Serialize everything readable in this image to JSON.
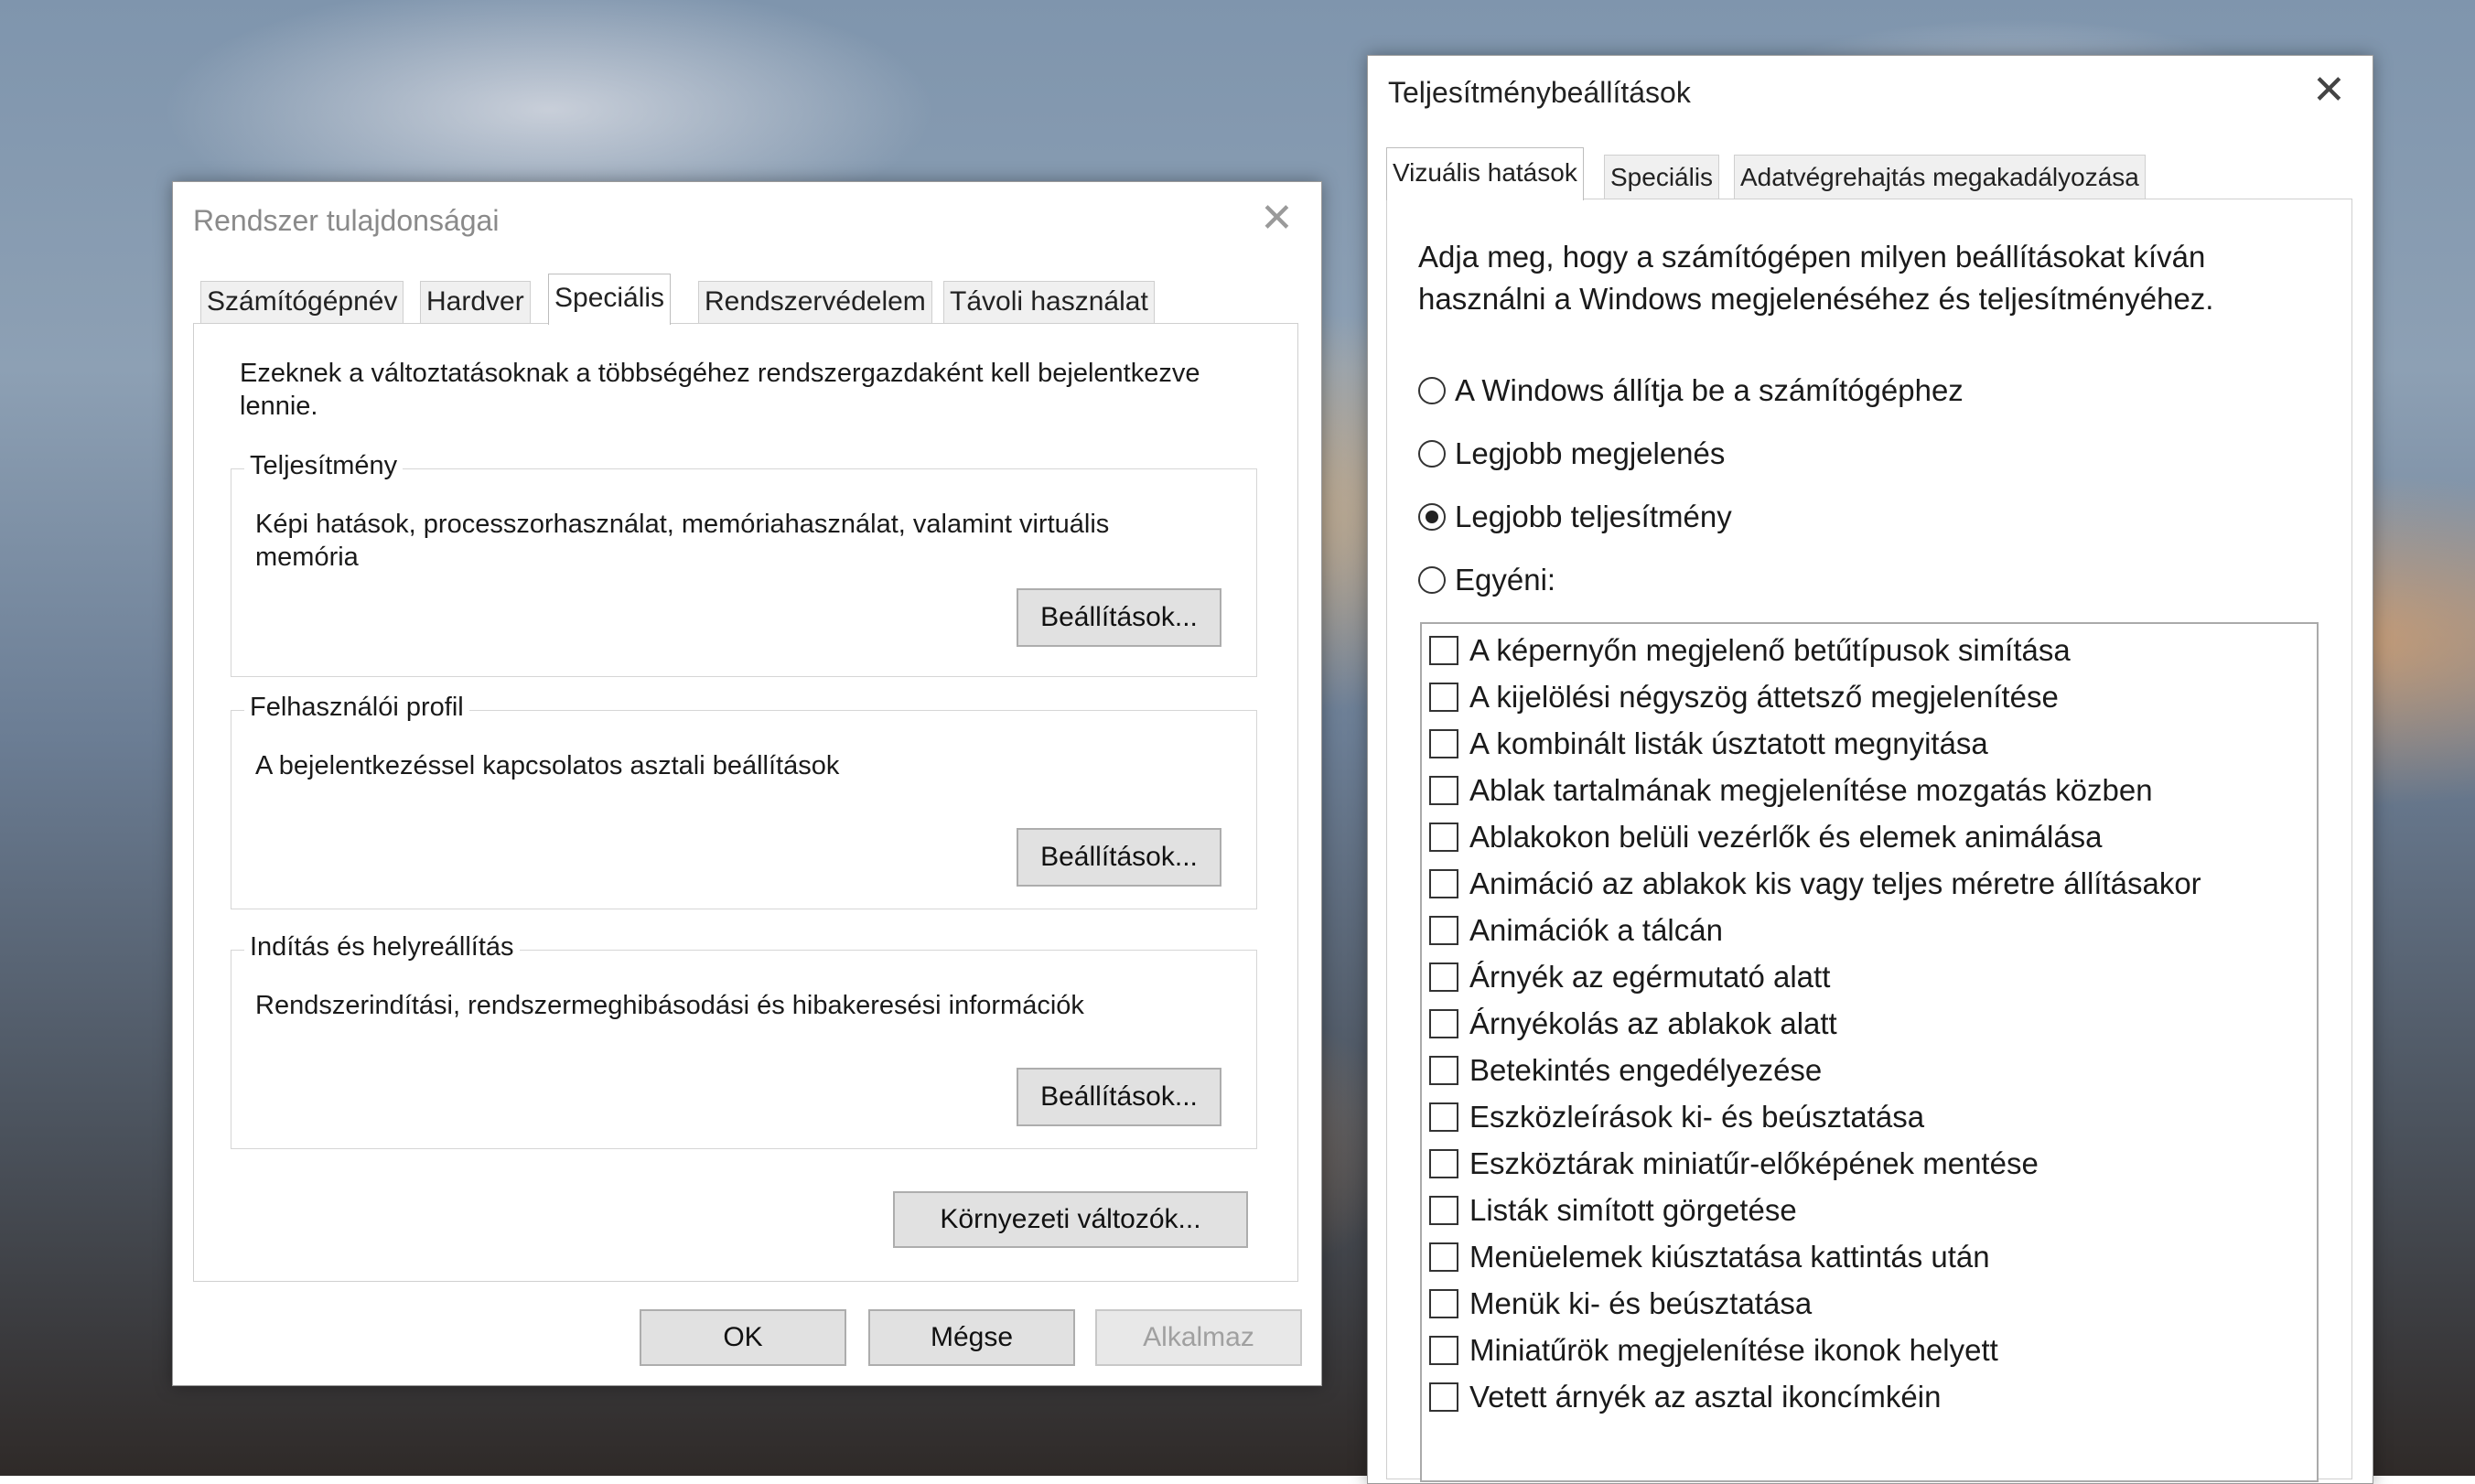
{
  "sys_dialog": {
    "title": "Rendszer tulajdonságai",
    "tabs": [
      {
        "label": "Számítógépnév"
      },
      {
        "label": "Hardver"
      },
      {
        "label": "Speciális"
      },
      {
        "label": "Rendszervédelem"
      },
      {
        "label": "Távoli használat"
      }
    ],
    "admin_note": "Ezeknek a változtatásoknak a többségéhez rendszergazdaként kell bejelentkezve lennie.",
    "performance": {
      "legend": "Teljesítmény",
      "desc": "Képi hatások, processzorhasználat, memóriahasználat, valamint virtuális memória",
      "button": "Beállítások..."
    },
    "user_profile": {
      "legend": "Felhasználói profil",
      "desc": "A bejelentkezéssel kapcsolatos asztali beállítások",
      "button": "Beállítások..."
    },
    "startup": {
      "legend": "Indítás és helyreállítás",
      "desc": "Rendszerindítási, rendszermeghibásodási és hibakeresési információk",
      "button": "Beállítások..."
    },
    "env_button": "Környezeti változók...",
    "ok_button": "OK",
    "cancel_button": "Mégse",
    "apply_button": "Alkalmaz"
  },
  "perf_dialog": {
    "title": "Teljesítménybeállítások",
    "tabs": [
      {
        "label": "Vizuális hatások"
      },
      {
        "label": "Speciális"
      },
      {
        "label": "Adatvégrehajtás megakadályozása"
      }
    ],
    "intro": "Adja meg, hogy a számítógépen milyen beállításokat kíván használni a Windows megjelenéséhez és teljesítményéhez.",
    "radios": [
      {
        "label": "A Windows állítja be a számítógéphez",
        "checked": false
      },
      {
        "label": "Legjobb megjelenés",
        "checked": false
      },
      {
        "label": "Legjobb teljesítmény",
        "checked": true
      },
      {
        "label": "Egyéni:",
        "checked": false
      }
    ],
    "options": [
      {
        "label": "A képernyőn megjelenő betűtípusok simítása"
      },
      {
        "label": "A kijelölési négyszög áttetsző megjelenítése"
      },
      {
        "label": "A kombinált listák úsztatott megnyitása"
      },
      {
        "label": "Ablak tartalmának megjelenítése mozgatás közben"
      },
      {
        "label": "Ablakokon belüli vezérlők és elemek animálása"
      },
      {
        "label": "Animáció az ablakok kis vagy teljes méretre állításakor"
      },
      {
        "label": "Animációk a tálcán"
      },
      {
        "label": "Árnyék az egérmutató alatt"
      },
      {
        "label": "Árnyékolás az ablakok alatt"
      },
      {
        "label": "Betekintés engedélyezése"
      },
      {
        "label": "Eszközleírások ki- és beúsztatása"
      },
      {
        "label": "Eszköztárak miniatűr-előképének mentése"
      },
      {
        "label": "Listák simított görgetése"
      },
      {
        "label": "Menüelemek kiúsztatása kattintás után"
      },
      {
        "label": "Menük ki- és beúsztatása"
      },
      {
        "label": "Miniatűrök megjelenítése ikonok helyett"
      },
      {
        "label": "Vetett árnyék az asztal ikoncímkéin"
      }
    ]
  }
}
